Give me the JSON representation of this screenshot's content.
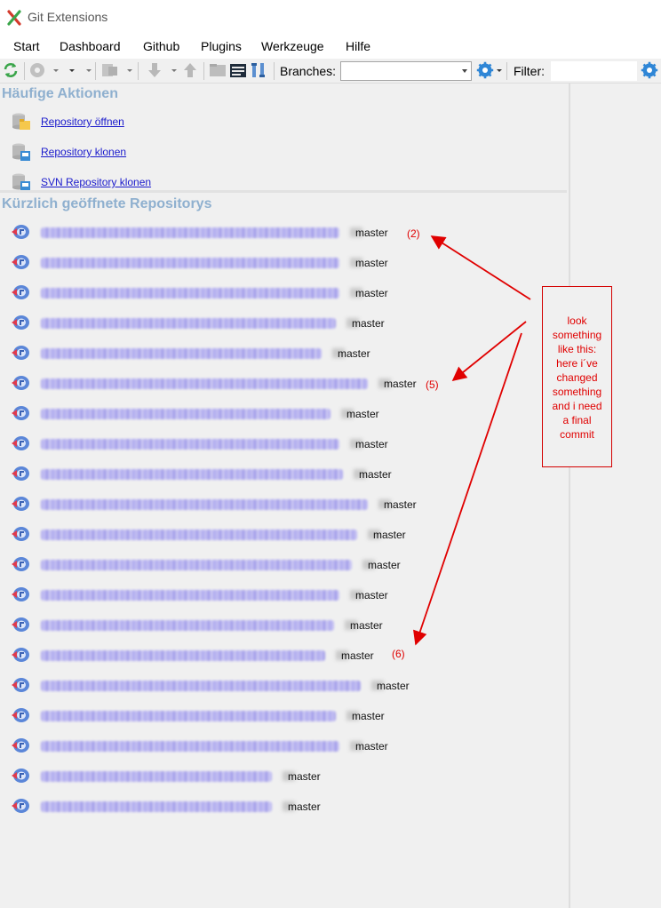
{
  "window": {
    "title": "Git Extensions"
  },
  "menu": [
    "Start",
    "Dashboard",
    "Github",
    "Plugins",
    "Werkzeuge",
    "Hilfe"
  ],
  "toolbar": {
    "branches_label": "Branches:",
    "filter_label": "Filter:",
    "branches_value": "",
    "filter_value": ""
  },
  "sections": {
    "common_actions": "Häufige Aktionen",
    "recent": "Kürzlich geöffnete Repositorys"
  },
  "actions": [
    {
      "label": "Repository öffnen",
      "icon": "open-repo-icon"
    },
    {
      "label": "Repository klonen",
      "icon": "clone-repo-icon"
    },
    {
      "label": "SVN Repository klonen",
      "icon": "svn-clone-icon"
    }
  ],
  "repos": [
    {
      "path_width": 336,
      "branch": "master"
    },
    {
      "path_width": 336,
      "branch": "master"
    },
    {
      "path_width": 336,
      "branch": "master"
    },
    {
      "path_width": 332,
      "branch": "master"
    },
    {
      "path_width": 316,
      "branch": "master"
    },
    {
      "path_width": 368,
      "branch": "master"
    },
    {
      "path_width": 326,
      "branch": "master"
    },
    {
      "path_width": 336,
      "branch": "master"
    },
    {
      "path_width": 340,
      "branch": "master"
    },
    {
      "path_width": 368,
      "branch": "master"
    },
    {
      "path_width": 356,
      "branch": "master"
    },
    {
      "path_width": 350,
      "branch": "master"
    },
    {
      "path_width": 336,
      "branch": "master"
    },
    {
      "path_width": 330,
      "branch": "master"
    },
    {
      "path_width": 320,
      "branch": "master"
    },
    {
      "path_width": 360,
      "branch": "master"
    },
    {
      "path_width": 332,
      "branch": "master"
    },
    {
      "path_width": 336,
      "branch": "master"
    },
    {
      "path_width": 260,
      "branch": "master"
    },
    {
      "path_width": 260,
      "branch": "master"
    }
  ],
  "annotations": {
    "labels": [
      "(2)",
      "(5)",
      "(6)"
    ],
    "note": [
      "look",
      "something",
      "like this:",
      "here i´ve",
      "changed",
      "something",
      "and i need",
      "a final",
      "commit"
    ]
  },
  "colors": {
    "section_title": "#8fb0cf",
    "link": "#1a1acc",
    "annotation": "#e00000"
  }
}
